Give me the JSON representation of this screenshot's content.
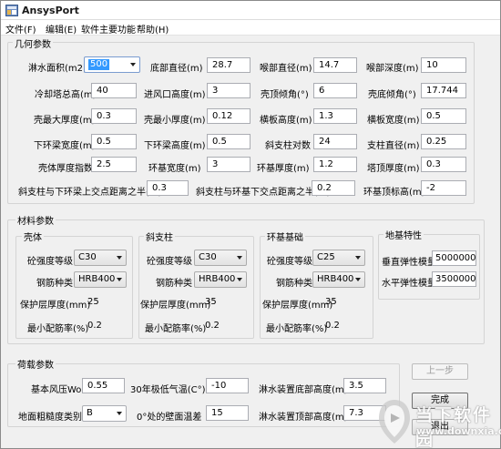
{
  "window": {
    "title": "AnsysPort"
  },
  "menu": [
    "文件(F)",
    "编辑(E)",
    "软件主要功能",
    "帮助(H)"
  ],
  "geometry": {
    "title": "几何参数",
    "fields": [
      {
        "label": "淋水面积(m2)",
        "value": "500"
      },
      {
        "label": "底部直径(m)",
        "value": "28.7"
      },
      {
        "label": "喉部直径(m)",
        "value": "14.7"
      },
      {
        "label": "喉部深度(m)",
        "value": "10"
      },
      {
        "label": "冷却塔总高(m)",
        "value": "40"
      },
      {
        "label": "进风口高度(m)",
        "value": "3"
      },
      {
        "label": "壳顶倾角(°)",
        "value": "6"
      },
      {
        "label": "壳底倾角(°)",
        "value": "17.744"
      },
      {
        "label": "壳最大厚度(m)",
        "value": "0.3"
      },
      {
        "label": "壳最小厚度(m)",
        "value": "0.12"
      },
      {
        "label": "横板高度(m)",
        "value": "1.3"
      },
      {
        "label": "横板宽度(m)",
        "value": "0.5"
      },
      {
        "label": "下环梁宽度(m)",
        "value": "0.5"
      },
      {
        "label": "下环梁高度(m)",
        "value": "0.5"
      },
      {
        "label": "斜支柱对数",
        "value": "24"
      },
      {
        "label": "支柱直径(m)",
        "value": "0.25"
      },
      {
        "label": "壳体厚度指数",
        "value": "2.5"
      },
      {
        "label": "环基宽度(m)",
        "value": "3"
      },
      {
        "label": "环基厚度(m)",
        "value": "1.2"
      },
      {
        "label": "塔顶厚度(m)",
        "value": "0.3"
      },
      {
        "label": "斜支柱与下环梁上交点距离之半(m)",
        "value": "0.3"
      },
      {
        "label": "斜支柱与环基下交点距离之半(m)",
        "value": "0.2"
      },
      {
        "label": "环基顶标高(m)",
        "value": "-2"
      }
    ]
  },
  "material": {
    "title": "材料参数",
    "panels": [
      {
        "title": "壳体",
        "concrete_label": "砼强度等级",
        "concrete": "C30",
        "rebar_label": "钢筋种类",
        "rebar": "HRB400",
        "cover_label": "保护层厚度(mm)",
        "cover": "25",
        "ratio_label": "最小配筋率(%)",
        "ratio": "0.2"
      },
      {
        "title": "斜支柱",
        "concrete_label": "砼强度等级",
        "concrete": "C30",
        "rebar_label": "钢筋种类",
        "rebar": "HRB400",
        "cover_label": "保护层厚度(mm)",
        "cover": "35",
        "ratio_label": "最小配筋率(%)",
        "ratio": "0.2"
      },
      {
        "title": "环基基础",
        "concrete_label": "砼强度等级",
        "concrete": "C25",
        "rebar_label": "钢筋种类",
        "rebar": "HRB400",
        "cover_label": "保护层厚度(mm)",
        "cover": "35",
        "ratio_label": "最小配筋率(%)",
        "ratio": "0.2"
      }
    ],
    "foundation": {
      "title": "地基特性",
      "vertical_label": "垂直弹性模量",
      "vertical": "50000000",
      "horizontal_label": "水平弹性模量",
      "horizontal": "35000000"
    }
  },
  "load": {
    "title": "荷载参数",
    "wind_label": "基本风压Wo",
    "wind": "0.55",
    "temp_label": "30年极低气温(C°)",
    "temp": "-10",
    "pool_bottom_label": "淋水装置底部高度(m)",
    "pool_bottom": "3.5",
    "roughness_label": "地面粗糙度类别",
    "roughness": "B",
    "wall_temp_label": "0°处的壁面温差",
    "wall_temp": "15",
    "pool_top_label": "淋水装置顶部高度(m)",
    "pool_top": "7.3"
  },
  "buttons": {
    "prev": "上一步",
    "finish": "完成",
    "exit": "退出"
  },
  "watermark": {
    "name": "当下软件园",
    "url": "www.downxia.com"
  },
  "colors": {
    "selection": "#3399ff",
    "window_bg": "#f0f0f0",
    "border": "#d4d4d4"
  }
}
